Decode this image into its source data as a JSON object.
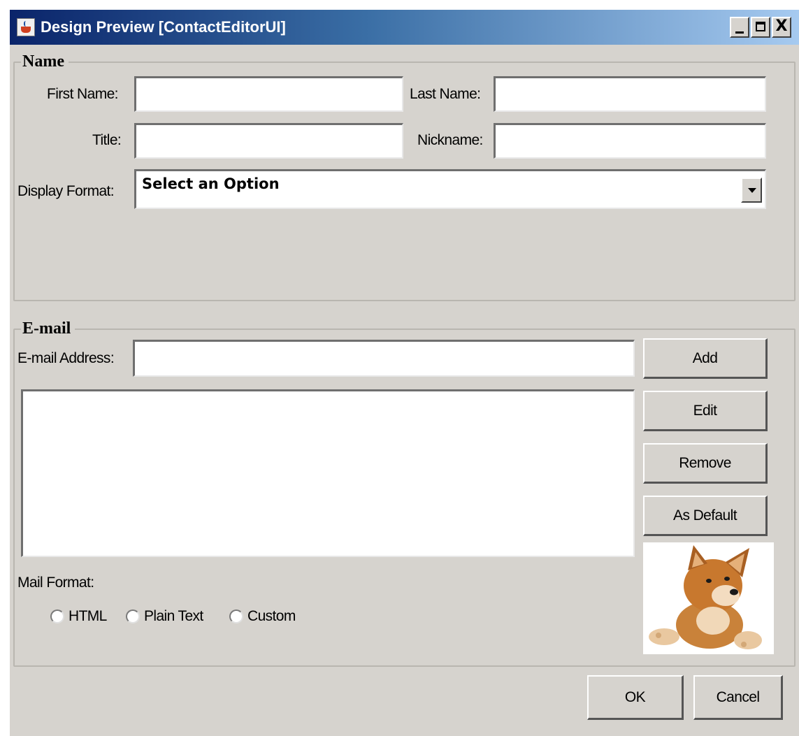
{
  "window": {
    "title": "Design Preview [ContactEditorUI]",
    "controls": {
      "minimize_icon": "minimize-icon",
      "maximize_icon": "maximize-icon",
      "close_icon": "close-icon",
      "close_glyph": "X"
    }
  },
  "name_section": {
    "legend": "Name",
    "first_name_label": "First Name:",
    "first_name_value": "",
    "last_name_label": "Last Name:",
    "last_name_value": "",
    "title_label": "Title:",
    "title_value": "",
    "nickname_label": "Nickname:",
    "nickname_value": "",
    "display_format_label": "Display Format:",
    "display_format_selected": "Select an Option"
  },
  "email_section": {
    "legend": "E-mail",
    "address_label": "E-mail Address:",
    "address_value": "",
    "buttons": {
      "add": "Add",
      "edit": "Edit",
      "remove": "Remove",
      "as_default": "As Default"
    },
    "addresses": [],
    "mail_format_label": "Mail Format:",
    "mail_format_options": [
      "HTML",
      "Plain Text",
      "Custom"
    ]
  },
  "photo": {
    "subject": "puppy"
  },
  "dialog_buttons": {
    "ok": "OK",
    "cancel": "Cancel"
  },
  "colors": {
    "window_bg": "#d6d3ce",
    "titlebar_start": "#0a246a",
    "titlebar_end": "#a6caf0"
  }
}
